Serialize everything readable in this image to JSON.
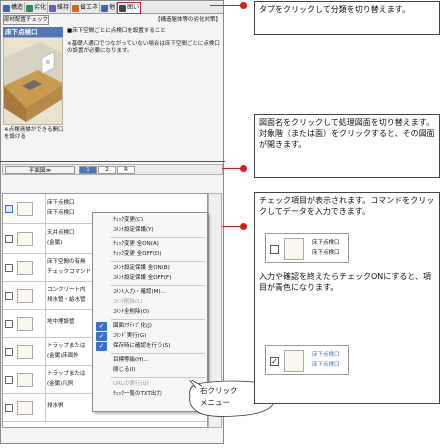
{
  "tabs": [
    {
      "label": "構造",
      "color": "#3a66b5"
    },
    {
      "label": "劣化",
      "color": "#2e8b57"
    },
    {
      "label": "維持",
      "color": "#6a5acd"
    },
    {
      "label": "省エネ",
      "color": "#d2691e"
    },
    {
      "label": "他",
      "color": "#3a66b5"
    },
    {
      "label": "囲い",
      "color": "#444444"
    }
  ],
  "header": {
    "check_button": "部材配置チェック",
    "category_title": "【構造躯体等の劣化対策】"
  },
  "topic": {
    "title": "床下点検口",
    "desc1": "■床下空間ごとに点検口を設置すること",
    "desc2": "※基礎人通口でつながっていない場合は床下空間ごとに点検口の設置が必要になります。",
    "note": "※点検清掃ができる開口を設ける"
  },
  "drawing": {
    "button": "平面図≫",
    "floors": [
      "1",
      "2",
      "R"
    ]
  },
  "list": [
    {
      "line1": "床下点検口",
      "line2": "床下点検口"
    },
    {
      "line1": "天井点検口",
      "line2": "(金属)"
    },
    {
      "line1": "床下空間の有無",
      "line2": "チェックコマンド"
    },
    {
      "line1": "コンクリート内",
      "line2": "排水管・給水管"
    },
    {
      "line1": "地中埋設管",
      "line2": ""
    },
    {
      "line1": "トラップまたは",
      "line2": "(金属)床面外"
    },
    {
      "line1": "トラップまたは",
      "line2": "(金属)凡例"
    },
    {
      "line1": "排水桝",
      "line2": ""
    }
  ],
  "context_menu": {
    "items": [
      {
        "label": "ﾁｪｯｸ変更(C)",
        "enabled": true,
        "checked": false
      },
      {
        "label": "ｺﾒﾝﾄ設定保護(Y)",
        "enabled": true,
        "checked": false
      },
      {
        "label": "ﾁｪｯｸ変更 全ON(A)",
        "enabled": true,
        "checked": false
      },
      {
        "label": "ﾁｪｯｸ変更 全OFF(D)",
        "enabled": true,
        "checked": false
      },
      {
        "label": "ｺﾒﾝﾄ設定保護 全ON(B)",
        "enabled": true,
        "checked": false
      },
      {
        "label": "ｺﾒﾝﾄ設定保護 全OFF(F)",
        "enabled": true,
        "checked": false
      },
      {
        "label": "ｺﾒﾝﾄ入力・確認(M)...",
        "enabled": true,
        "checked": false
      },
      {
        "label": "ｺﾒﾝﾄ削除(L)",
        "enabled": false,
        "checked": false
      },
      {
        "label": "ｺﾒﾝﾄ全削除(O)",
        "enabled": true,
        "checked": false
      },
      {
        "label": "図面ｱｸﾃｨﾌﾞ化(J)",
        "enabled": true,
        "checked": true
      },
      {
        "label": "ｺﾏﾝﾄﾞ実行(G)",
        "enabled": true,
        "checked": true
      },
      {
        "label": "保存時に確認を行う(S)",
        "enabled": true,
        "checked": true
      },
      {
        "label": "目標等級(H)...",
        "enabled": true,
        "checked": false
      },
      {
        "label": "閉じる(I)",
        "enabled": true,
        "checked": false
      },
      {
        "label": "URLの実行(U)",
        "enabled": false,
        "checked": false
      },
      {
        "label": "ﾁｪｯｸ一覧のTXT出力",
        "enabled": true,
        "checked": false
      }
    ]
  },
  "bubble": {
    "line1": "右クリック",
    "line2": "メニュー"
  },
  "annotations": {
    "tabs_note": "タブをクリックして分類を切り替えます。",
    "drawing_note": "図面名をクリックして処理図面を切り替えます。対象階（または面）をクリックすると、その図面が開きます。",
    "check_note": "チェック項目が表示されます。コマンドをクリックしてデータを入力できます。",
    "check_note2": "入力や確認を終えたらチェックONにすると、項目が青色になります。",
    "sample1": {
      "line1": "床下点検口",
      "line2": "床下点検口"
    },
    "sample2": {
      "line1": "床下点検口",
      "line2": "床下点検口"
    }
  },
  "colors": {
    "accent_red": "#d81b1b",
    "checked_blue": "#3b6fd0",
    "header_blue": "#4f76b8"
  }
}
